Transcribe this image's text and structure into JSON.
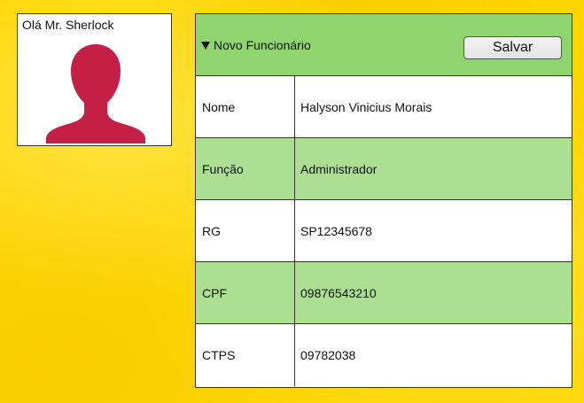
{
  "profile": {
    "greeting": "Olá Mr. Sherlock",
    "avatar_icon": "user-silhouette-icon",
    "avatar_color": "#c41f45"
  },
  "form": {
    "header": {
      "title": "Novo Funcionário",
      "collapse_icon": "triangle-down-icon",
      "save_label": "Salvar"
    },
    "rows": [
      {
        "label": "Nome",
        "value": "Halyson Vinicius Morais"
      },
      {
        "label": "Função",
        "value": "Administrador"
      },
      {
        "label": "RG",
        "value": "SP12345678"
      },
      {
        "label": "CPF",
        "value": "09876543210"
      },
      {
        "label": "CTPS",
        "value": "09782038"
      }
    ]
  },
  "colors": {
    "background": "#ffd500",
    "header_green": "#8fd46f",
    "row_green": "#acdf92"
  }
}
